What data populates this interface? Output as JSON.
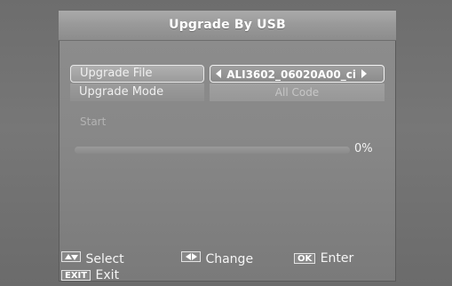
{
  "dialog": {
    "title": "Upgrade By USB"
  },
  "menu": {
    "upgrade_file": {
      "label": "Upgrade File",
      "value": "ALI3602_06020A00_ci"
    },
    "upgrade_mode": {
      "label": "Upgrade Mode",
      "value": "All Code"
    },
    "start": {
      "label": "Start"
    }
  },
  "progress": {
    "percent": 0,
    "text": "0%"
  },
  "help": {
    "select_key": "▲▼",
    "select_label": "Select",
    "change_key": "◀▶",
    "change_label": "Change",
    "ok_key": "OK",
    "ok_label": "Enter",
    "exit_key": "EXIT",
    "exit_label": "Exit"
  },
  "colors": {
    "panel_bg": "#888888",
    "text": "#f5f5f5",
    "disabled_text": "#b3b3b3"
  }
}
